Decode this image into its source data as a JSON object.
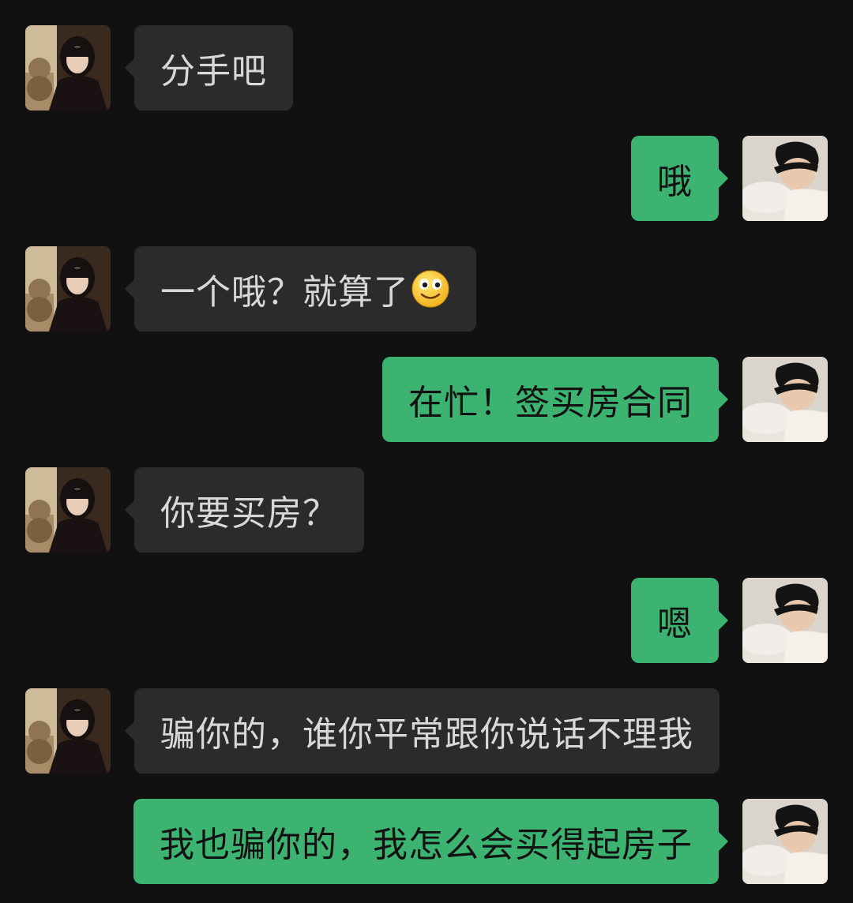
{
  "chat": {
    "messages": [
      {
        "sender": "her",
        "text": "分手吧"
      },
      {
        "sender": "me",
        "text": "哦"
      },
      {
        "sender": "her",
        "text": "一个哦？就算了",
        "emoji": "smiling-face-emoji"
      },
      {
        "sender": "me",
        "text": "在忙！签买房合同"
      },
      {
        "sender": "her",
        "text": "你要买房？"
      },
      {
        "sender": "me",
        "text": "嗯"
      },
      {
        "sender": "her",
        "text": "骗你的，谁你平常跟你说话不理我"
      },
      {
        "sender": "me",
        "text": "我也骗你的，我怎么会买得起房子"
      }
    ]
  },
  "colors": {
    "background": "#111111",
    "incoming_bubble": "#2b2b2b",
    "outgoing_bubble": "#3cb371"
  }
}
